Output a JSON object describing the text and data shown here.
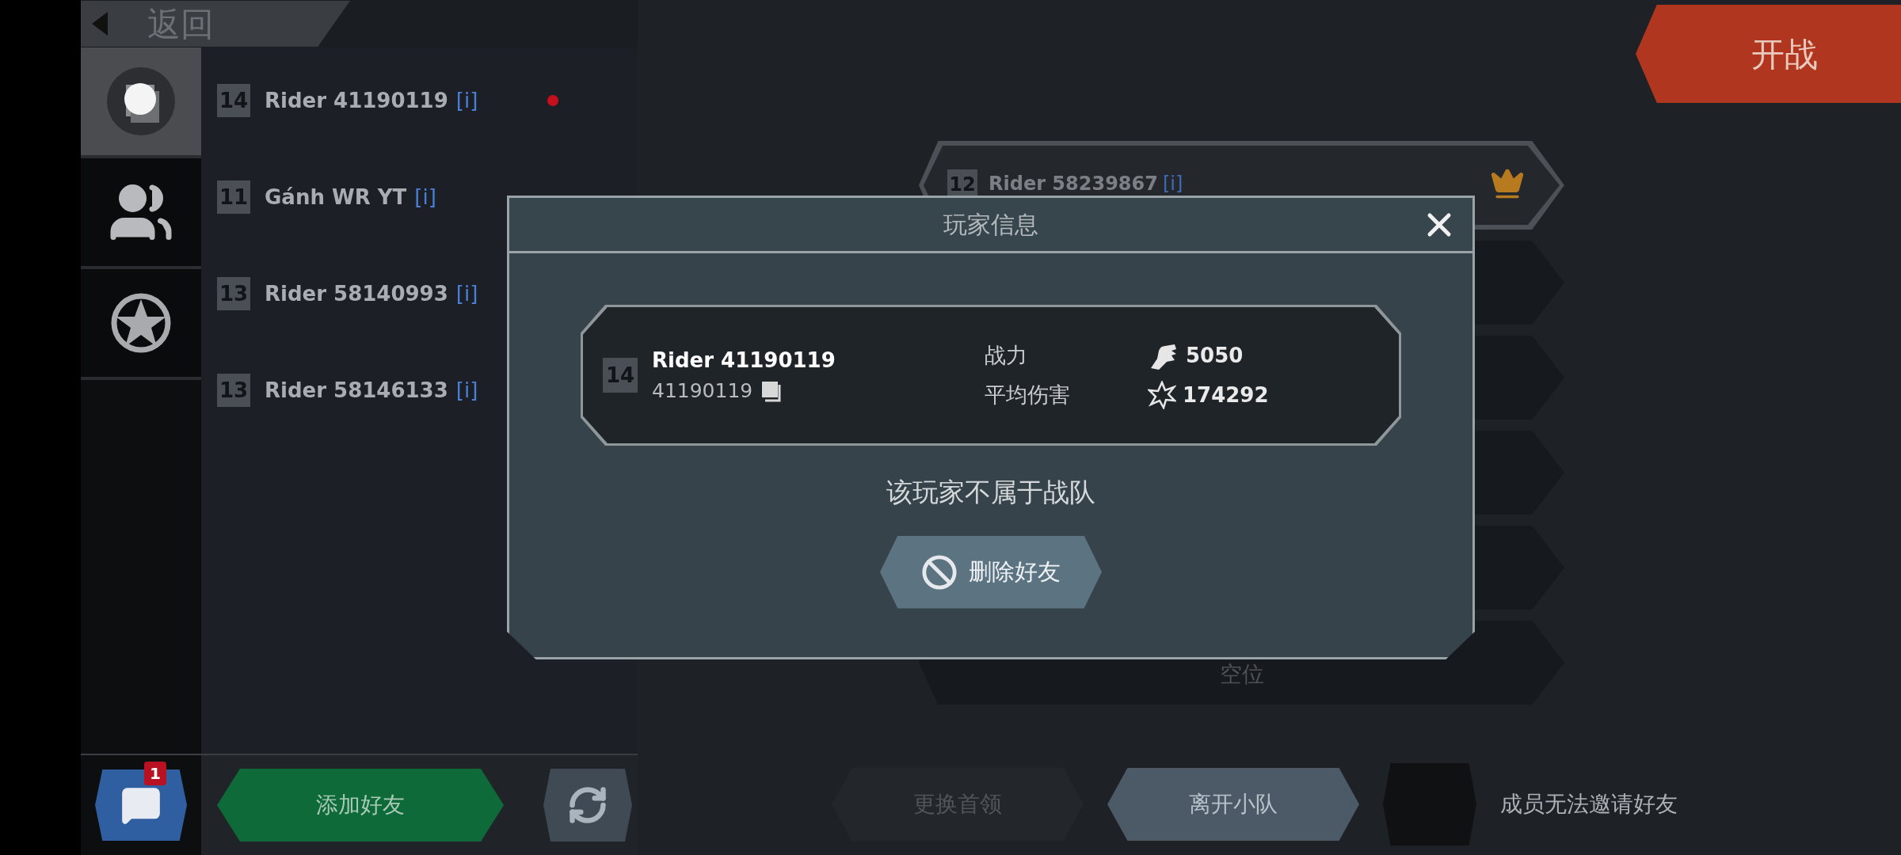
{
  "top_bar": {
    "back_label": "返回",
    "start_button": "开战"
  },
  "sidebar_tabs": [
    {
      "kind": "avatar",
      "selected": true
    },
    {
      "kind": "group",
      "selected": false
    },
    {
      "kind": "star",
      "selected": false
    }
  ],
  "friends": [
    {
      "rank": "14",
      "name": "Rider 41190119",
      "info": "[i]",
      "unread": true
    },
    {
      "rank": "11",
      "name": "Gánh WR YT",
      "info": "[i]",
      "unread": false
    },
    {
      "rank": "13",
      "name": "Rider 58140993",
      "info": "[i]",
      "unread": false
    },
    {
      "rank": "13",
      "name": "Rider 58146133",
      "info": "[i]",
      "unread": false
    }
  ],
  "chat": {
    "badge": "1"
  },
  "friend_actions": {
    "add_button": "添加好友"
  },
  "team": {
    "slots": [
      {
        "kind": "member",
        "rank": "12",
        "name": "Rider 58239867",
        "info": "[i]",
        "leader": true
      },
      {
        "kind": "empty"
      },
      {
        "kind": "empty"
      },
      {
        "kind": "empty"
      },
      {
        "kind": "empty"
      },
      {
        "kind": "empty",
        "label": "空位"
      }
    ]
  },
  "team_actions": {
    "change_leader": {
      "label": "更换首领",
      "disabled": true
    },
    "leave": {
      "label": "离开小队",
      "disabled": false
    },
    "invite_note": "成员无法邀请好友"
  },
  "dialog": {
    "title": "玩家信息",
    "player": {
      "rank": "14",
      "name": "Rider 41190119",
      "id": "41190119"
    },
    "stats": [
      {
        "kind": "power",
        "label": "战力",
        "value": "5050"
      },
      {
        "kind": "damage",
        "label": "平均伤害",
        "value": "174292"
      }
    ],
    "message": "该玩家不属于战队",
    "delete_button": "删除好友"
  }
}
